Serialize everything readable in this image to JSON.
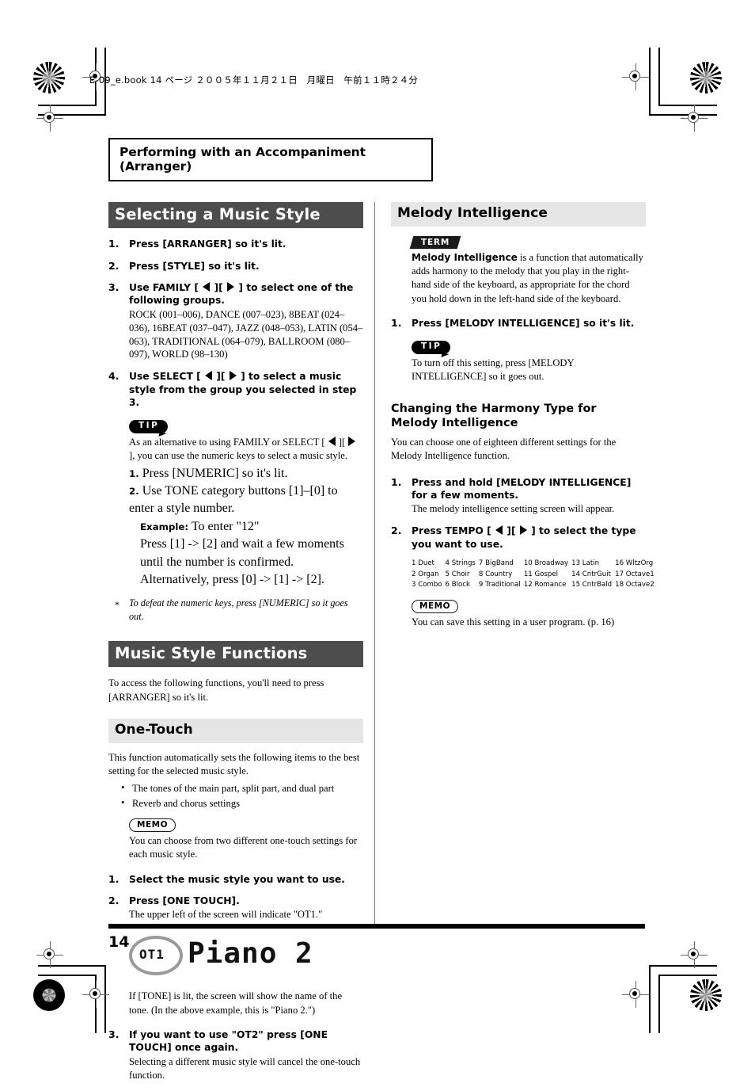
{
  "file_header": "E-09_e.book  14 ページ  ２００５年１１月２１日　月曜日　午前１１時２４分",
  "chapter_title": "Performing with an Accompaniment (Arranger)",
  "page_number": "14",
  "left_column": {
    "section1": {
      "heading": "Selecting a Music Style",
      "steps": [
        {
          "num": "1.",
          "lead": "Press [ARRANGER] so it's lit."
        },
        {
          "num": "2.",
          "lead": "Press [STYLE] so it's lit."
        },
        {
          "num": "3.",
          "lead_pre": "Use FAMILY [",
          "lead_post": "] to select one of the following groups.",
          "sub": "ROCK (001–006), DANCE (007–023), 8BEAT (024–036), 16BEAT (037–047), JAZZ (048–053), LATIN (054–063), TRADITIONAL (064–079), BALLROOM (080–097), WORLD (98–130)"
        },
        {
          "num": "4.",
          "lead_pre": "Use SELECT [",
          "lead_post": "] to select a music style from the group you selected in step 3."
        }
      ],
      "tip": {
        "badge": "TIP",
        "text_pre": "As an alternative to using FAMILY or SELECT [",
        "text_post": "], you can use the numeric keys to select a music style.",
        "sub_steps": [
          {
            "n": "1.",
            "text": "Press [NUMERIC] so it's lit."
          },
          {
            "n": "2.",
            "text": "Use TONE category buttons [1]–[0] to enter a style number."
          }
        ],
        "example_label": "Example:",
        "example_text": "To enter \"12\"",
        "example_detail": "Press [1] -> [2] and wait a few moments until the number is confirmed. Alternatively, press [0] -> [1] -> [2]."
      },
      "footnote": "To defeat the numeric keys, press [NUMERIC] so it goes out."
    },
    "section2": {
      "heading": "Music Style Functions",
      "intro": "To access the following functions, you'll need to press [ARRANGER] so it's lit.",
      "subheading": "One-Touch",
      "intro2": "This function automatically sets the following items to the best setting for the selected music style.",
      "bullets": [
        "The tones of the main part, split part, and dual part",
        "Reverb and chorus settings"
      ],
      "memo": {
        "badge": "MEMO",
        "text": "You can choose from two different one-touch settings for each music style."
      },
      "steps": [
        {
          "num": "1.",
          "lead": "Select the music style you want to use."
        },
        {
          "num": "2.",
          "lead": "Press [ONE TOUCH].",
          "sub": "The upper left of the screen will indicate \"OT1.\""
        }
      ],
      "lcd": {
        "indicator": "OT1",
        "tone_name": "Piano 2"
      },
      "after_lcd": "If [TONE] is lit, the screen will show the name of the tone. (In the above example, this is \"Piano 2.\")",
      "step3": {
        "num": "3.",
        "lead": "If you want to use \"OT2\" press [ONE TOUCH] once again.",
        "sub": "Selecting a different music style will cancel the one-touch function."
      }
    }
  },
  "right_column": {
    "heading": "Melody Intelligence",
    "term": {
      "badge": "TERM",
      "bold_lead": "Melody Intelligence",
      "text": " is a function that automatically adds harmony to the melody that you play in the right-hand side of the keyboard, as appropriate for the chord you hold down in the left-hand side of the keyboard."
    },
    "step1": {
      "num": "1.",
      "lead": "Press [MELODY INTELLIGENCE] so it's lit."
    },
    "tip": {
      "badge": "TIP",
      "text": "To turn off this setting, press [MELODY INTELLIGENCE] so it goes out."
    },
    "subheading": "Changing the Harmony Type for Melody Intelligence",
    "intro": "You can choose one of eighteen different settings for the Melody Intelligence function.",
    "steps": [
      {
        "num": "1.",
        "lead": "Press and hold [MELODY INTELLIGENCE] for a few moments.",
        "sub": "The melody intelligence setting screen will appear."
      },
      {
        "num": "2.",
        "lead_pre": "Press TEMPO [",
        "lead_post": "] to select the type you want to use."
      }
    ],
    "harmony_types": [
      "1 Duet",
      "2 Organ",
      "3 Combo",
      "4 Strings",
      "5 Choir",
      "6 Block",
      "7 BigBand",
      "8 Country",
      "9 Traditional",
      "10 Broadway",
      "11 Gospel",
      "12 Romance",
      "13 Latin",
      "14 CntrGuit",
      "15 CntrBald",
      "16 WltzOrg",
      "17 Octave1",
      "18 Octave2"
    ],
    "memo": {
      "badge": "MEMO",
      "text": "You can save this setting in a user program. (p. 16)"
    }
  }
}
